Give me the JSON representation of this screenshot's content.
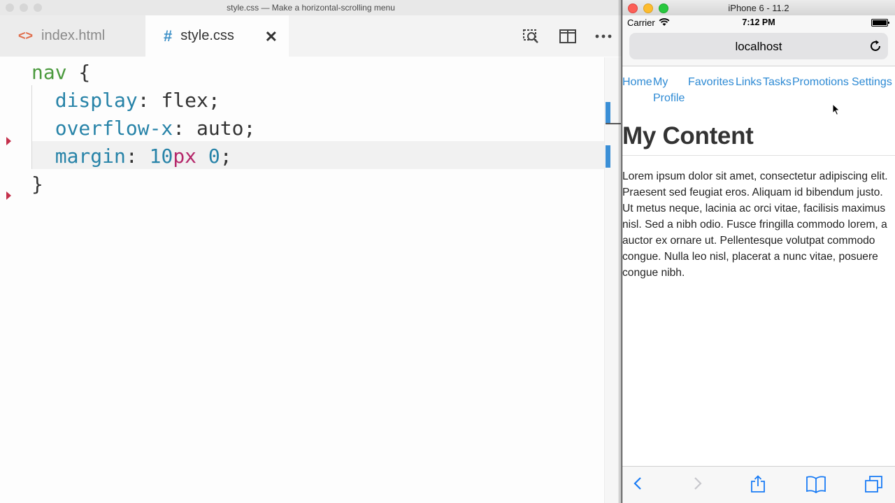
{
  "editor": {
    "window_title": "style.css — Make a horizontal-scrolling menu",
    "tabs": [
      {
        "label": "index.html",
        "icon": "code-brackets-icon"
      },
      {
        "label": "style.css",
        "icon": "hash-icon"
      }
    ],
    "close_icon": "×",
    "code": {
      "l1_selector": "nav",
      "l1_brace": " {",
      "l2_prop": "display",
      "l2_value": ": flex;",
      "l3_prop": "overflow-x",
      "l3_value": ": auto;",
      "l4_prop": "margin",
      "l4_colon": ": ",
      "l4_num1": "10",
      "l4_unit": "px",
      "l4_space": " ",
      "l4_num2": "0",
      "l4_semi": ";",
      "l5_brace": "}"
    }
  },
  "simulator": {
    "window_title": "iPhone 6 - 11.2",
    "status": {
      "carrier": "Carrier",
      "time": "7:12 PM"
    },
    "url": "localhost",
    "nav_items": [
      {
        "label": "Home"
      },
      {
        "label": "My Profile"
      },
      {
        "label": "Favorites"
      },
      {
        "label": "Links"
      },
      {
        "label": "Tasks"
      },
      {
        "label": "Promotions"
      },
      {
        "label": "Settings"
      }
    ],
    "heading": "My Content",
    "paragraph": "Lorem ipsum dolor sit amet, consectetur adipiscing elit. Praesent sed feugiat eros. Aliquam id bibendum justo. Ut metus neque, lacinia ac orci vitae, facilisis maximus nisl. Sed a nibh odio. Fusce fringilla commodo lorem, a auctor ex ornare ut. Pellentesque volutpat commodo congue. Nulla leo nisl, placerat a nunc vitae, posuere congue nibh."
  },
  "colors": {
    "link": "#2d8ad4",
    "css_property": "#2783a8",
    "css_selector": "#4b9a3e",
    "css_unit": "#b5276a",
    "safari_blue": "#1a7cf5"
  }
}
